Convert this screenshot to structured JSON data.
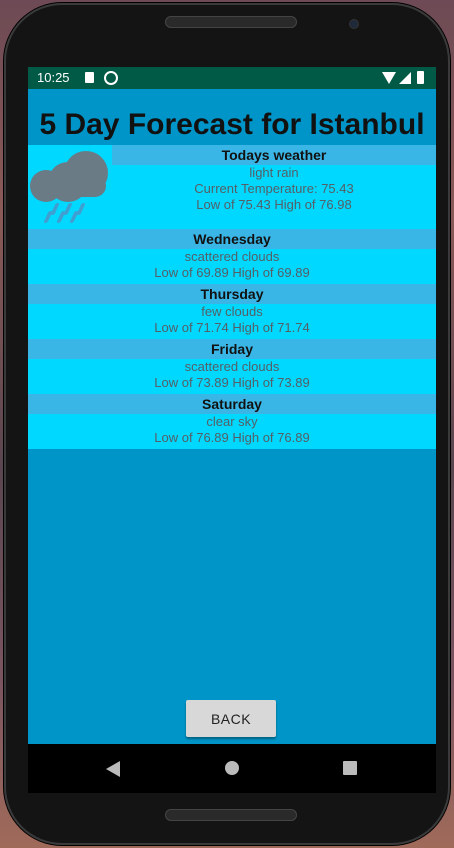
{
  "status_bar": {
    "time": "10:25"
  },
  "app": {
    "title": "5 Day Forecast for Istanbul"
  },
  "today": {
    "header": "Todays weather",
    "condition": "light rain",
    "current_temp": "Current Temperature: 75.43",
    "low_high": "Low of 75.43  High of 76.98",
    "icon": "rain-cloud-icon"
  },
  "days": [
    {
      "name": "Wednesday",
      "condition": "scattered clouds",
      "low_high": "Low of 69.89  High of 69.89"
    },
    {
      "name": "Thursday",
      "condition": "few clouds",
      "low_high": "Low of 71.74  High of 71.74"
    },
    {
      "name": "Friday",
      "condition": "scattered clouds",
      "low_high": "Low of 73.89  High of 73.89"
    },
    {
      "name": "Saturday",
      "condition": "clear sky",
      "low_high": "Low of 76.89  High of 76.89"
    }
  ],
  "back_label": "BACK",
  "colors": {
    "background": "#0095c8",
    "header": "#3ab6e6",
    "row": "#00d8ff",
    "status_bar": "#005a46"
  }
}
